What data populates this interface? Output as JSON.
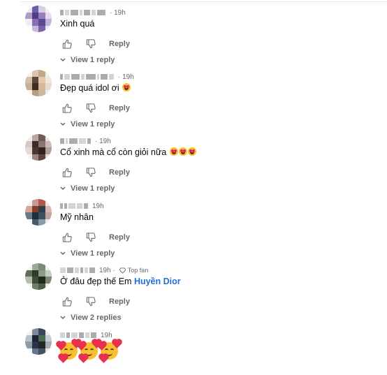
{
  "labels": {
    "reply": "Reply",
    "top_fan": "Top fan"
  },
  "comments": [
    {
      "time": "· 19h",
      "text": "Xinh quá",
      "view": "View 1 reply"
    },
    {
      "time": "· 19h",
      "text": "Đẹp quá idol ơi",
      "view": "View 1 reply"
    },
    {
      "time": "· 19h",
      "text": "Cổ xinh mà cổ còn giỏi nữa",
      "view": "View 1 reply"
    },
    {
      "time": "19h",
      "text": "Mỹ nhân",
      "view": "View 1 reply"
    },
    {
      "time": "19h ·",
      "text": "Ở đâu đẹp thế Em",
      "mention": "Huyền Dior",
      "view": "View 2 replies"
    },
    {
      "time": "19h",
      "text": ""
    }
  ],
  "colors": {
    "link": "#216fdb",
    "muted": "#65676b"
  }
}
